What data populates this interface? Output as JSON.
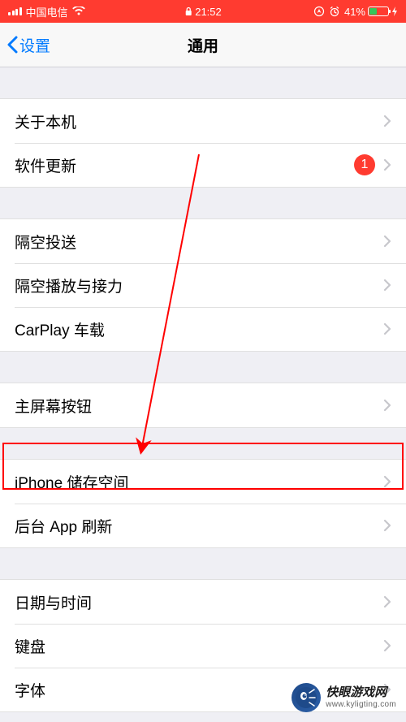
{
  "statusBar": {
    "carrier": "中国电信",
    "time": "21:52",
    "batteryPercent": "41%"
  },
  "nav": {
    "backLabel": "设置",
    "title": "通用"
  },
  "groups": [
    {
      "items": [
        {
          "key": "about",
          "label": "关于本机"
        },
        {
          "key": "software-update",
          "label": "软件更新",
          "badge": "1"
        }
      ]
    },
    {
      "items": [
        {
          "key": "airdrop",
          "label": "隔空投送"
        },
        {
          "key": "airplay",
          "label": "隔空播放与接力"
        },
        {
          "key": "carplay",
          "label": "CarPlay 车载"
        }
      ]
    },
    {
      "items": [
        {
          "key": "home-button",
          "label": "主屏幕按钮"
        }
      ]
    },
    {
      "items": [
        {
          "key": "iphone-storage",
          "label": "iPhone 储存空间"
        },
        {
          "key": "background-refresh",
          "label": "后台 App 刷新"
        }
      ]
    },
    {
      "items": [
        {
          "key": "date-time",
          "label": "日期与时间"
        },
        {
          "key": "keyboard",
          "label": "键盘"
        },
        {
          "key": "fonts",
          "label": "字体"
        }
      ]
    }
  ],
  "watermark": {
    "title": "快眼游戏网",
    "url": "www.kyligting.com"
  }
}
